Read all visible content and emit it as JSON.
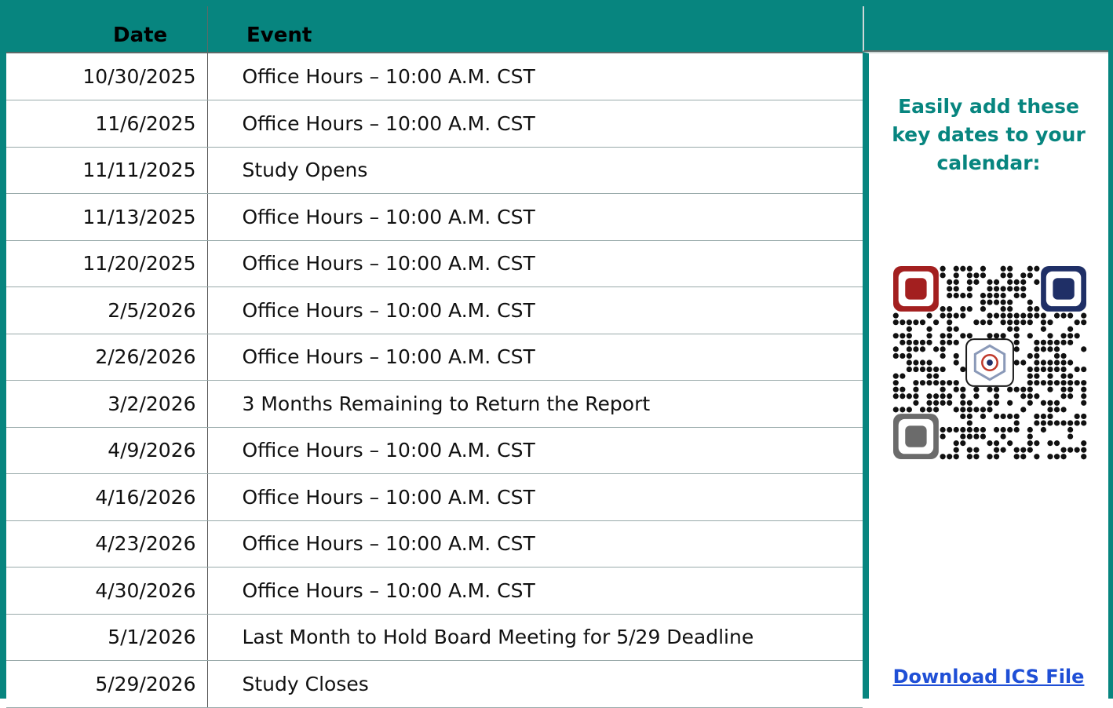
{
  "table": {
    "headers": {
      "date": "Date",
      "event": "Event"
    },
    "rows": [
      {
        "date": "10/30/2025",
        "event": "Office Hours – 10:00 A.M. CST"
      },
      {
        "date": "11/6/2025",
        "event": "Office Hours – 10:00 A.M. CST"
      },
      {
        "date": "11/11/2025",
        "event": "Study Opens"
      },
      {
        "date": "11/13/2025",
        "event": "Office Hours – 10:00 A.M. CST"
      },
      {
        "date": "11/20/2025",
        "event": "Office Hours – 10:00 A.M. CST"
      },
      {
        "date": "2/5/2026",
        "event": "Office Hours – 10:00 A.M. CST"
      },
      {
        "date": "2/26/2026",
        "event": "Office Hours – 10:00 A.M. CST"
      },
      {
        "date": "3/2/2026",
        "event": "3 Months Remaining to Return the Report"
      },
      {
        "date": "4/9/2026",
        "event": "Office Hours – 10:00 A.M. CST"
      },
      {
        "date": "4/16/2026",
        "event": "Office Hours – 10:00 A.M. CST"
      },
      {
        "date": "4/23/2026",
        "event": "Office Hours – 10:00 A.M. CST"
      },
      {
        "date": "4/30/2026",
        "event": "Office Hours – 10:00 A.M. CST"
      },
      {
        "date": "5/1/2026",
        "event": "Last Month to Hold Board Meeting for 5/29 Deadline"
      },
      {
        "date": "5/29/2026",
        "event": "Study Closes"
      }
    ]
  },
  "side": {
    "title": "Easily add these\nkey dates to your\ncalendar:",
    "qr_icon": "qr-code-icon",
    "link_label": "Download ICS File"
  },
  "colors": {
    "accent": "#07857f",
    "link": "#1f4fd6",
    "qr_corner_top_left": "#a31f1f",
    "qr_corner_top_right": "#1f2f66",
    "qr_corner_bottom_left": "#6b6b6b"
  }
}
